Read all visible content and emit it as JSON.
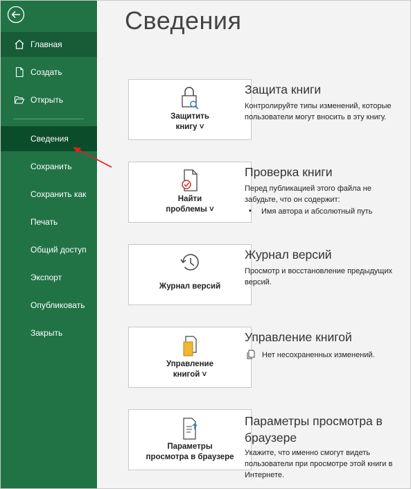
{
  "nav": {
    "home": "Главная",
    "create": "Создать",
    "open": "Открыть",
    "info": "Сведения",
    "save": "Сохранить",
    "save_as": "Сохранить как",
    "print": "Печать",
    "share": "Общий доступ",
    "export": "Экспорт",
    "publish": "Опубликовать",
    "close": "Закрыть"
  },
  "page_title": "Сведения",
  "sections": {
    "protect": {
      "card_line1": "Защитить",
      "card_line2": "книгу ˅",
      "title": "Защита книги",
      "desc": "Контролируйте типы изменений, которые пользователи могут вносить в эту книгу."
    },
    "inspect": {
      "card_line1": "Найти",
      "card_line2": "проблемы ˅",
      "title": "Проверка книги",
      "desc": "Перед публикацией этого файла не забудьте, что он содержит:",
      "bullet": "Имя автора и абсолютный путь"
    },
    "versions": {
      "card_label": "Журнал версий",
      "title": "Журнал версий",
      "desc": "Просмотр и восстановление предыдущих версий."
    },
    "manage": {
      "card_line1": "Управление",
      "card_line2": "книгой ˅",
      "title": "Управление книгой",
      "status": "Нет несохраненных изменений."
    },
    "browser": {
      "card_line1": "Параметры",
      "card_line2": "просмотра в браузере",
      "title_line1": "Параметры просмотра в",
      "title_line2": "браузере",
      "desc": "Укажите, что именно смогут видеть пользователи при просмотре этой книги в Интернете."
    }
  },
  "colors": {
    "sidebar": "#217346",
    "sidebar_selected": "#0b4d2a",
    "annotation_arrow": "#e02020"
  }
}
